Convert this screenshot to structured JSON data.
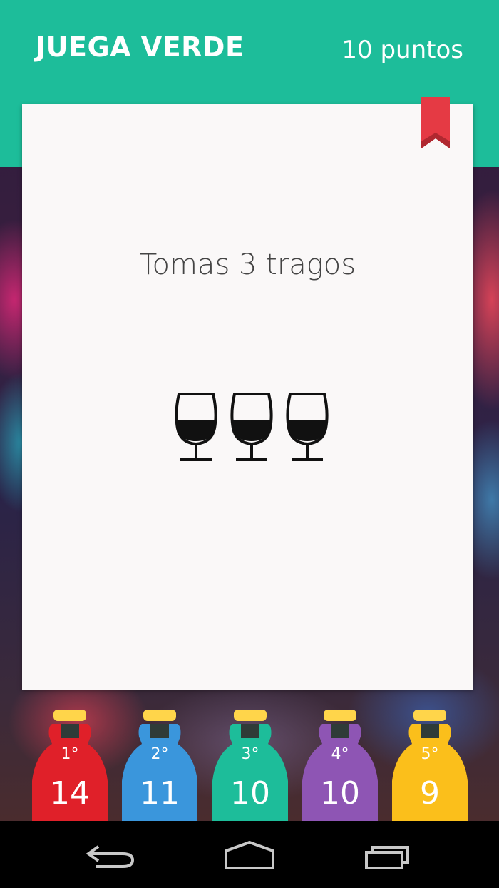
{
  "header": {
    "title": "JUEGA VERDE",
    "points": "10 puntos"
  },
  "card": {
    "text": "Tomas 3 tragos",
    "glass_count": 3,
    "icon": "wine-glass-icon"
  },
  "colors": {
    "header": "#1dbd9a",
    "bookmark": "#e53a44",
    "bottle_cap": "#ffd54a",
    "bottles": [
      "#e02029",
      "#3a96dc",
      "#1dbd9a",
      "#8e55b4",
      "#fbbf1b"
    ]
  },
  "players": [
    {
      "rank": "1°",
      "score": "14"
    },
    {
      "rank": "2°",
      "score": "11"
    },
    {
      "rank": "3°",
      "score": "10"
    },
    {
      "rank": "4°",
      "score": "10"
    },
    {
      "rank": "5°",
      "score": "9"
    }
  ],
  "navigation": {
    "icons": [
      "back-icon",
      "home-icon",
      "recent-apps-icon"
    ]
  }
}
